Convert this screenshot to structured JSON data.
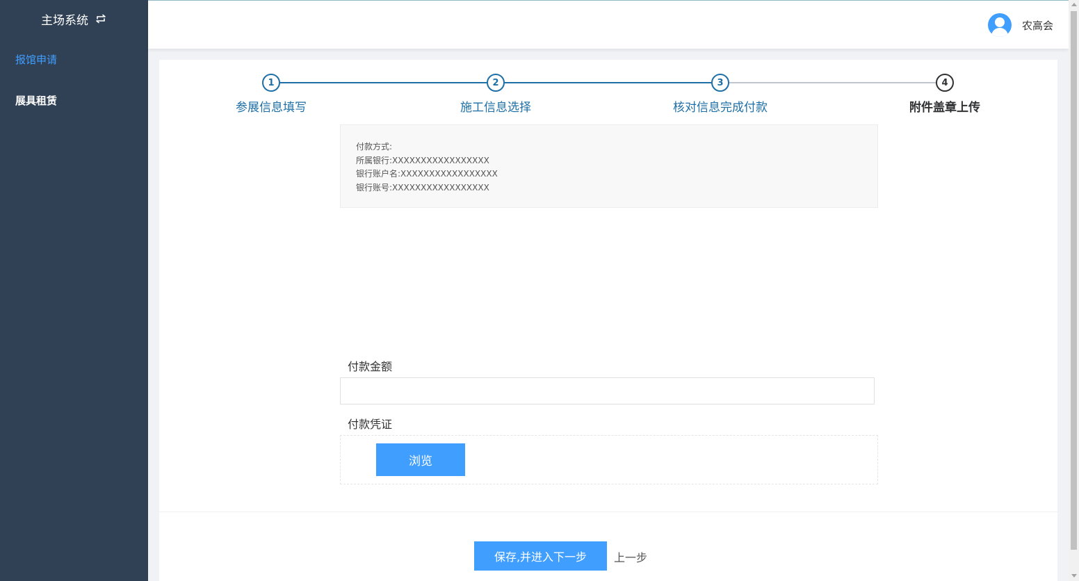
{
  "sidebar": {
    "title": "主场系统",
    "swap_icon": "swap-icon",
    "items": [
      {
        "label": "报馆申请",
        "active": true
      },
      {
        "label": "展具租赁",
        "active": false
      }
    ]
  },
  "header": {
    "avatar_icon": "user-avatar-icon",
    "username": "农高会"
  },
  "steps": [
    {
      "number": "1",
      "title": "参展信息填写",
      "status": "done"
    },
    {
      "number": "2",
      "title": "施工信息选择",
      "status": "done"
    },
    {
      "number": "3",
      "title": "核对信息完成付款",
      "status": "done"
    },
    {
      "number": "4",
      "title": "附件盖章上传",
      "status": "current"
    }
  ],
  "payment_info": {
    "method": "付款方式:",
    "bank": "所属银行:XXXXXXXXXXXXXXXXX",
    "account_name": "银行账户名:XXXXXXXXXXXXXXXXX",
    "account_number": "银行账号:XXXXXXXXXXXXXXXXX"
  },
  "form": {
    "amount_label": "付款金额",
    "amount_value": "",
    "voucher_label": "付款凭证",
    "browse_label": "浏览"
  },
  "actions": {
    "save_next_label": "保存,并进入下一步",
    "prev_label": "上一步"
  },
  "colors": {
    "sidebar_bg": "#304156",
    "active_nav": "#409eff",
    "primary_button": "#409eff",
    "step_done": "#1d6fa5",
    "step_current": "#303133"
  }
}
